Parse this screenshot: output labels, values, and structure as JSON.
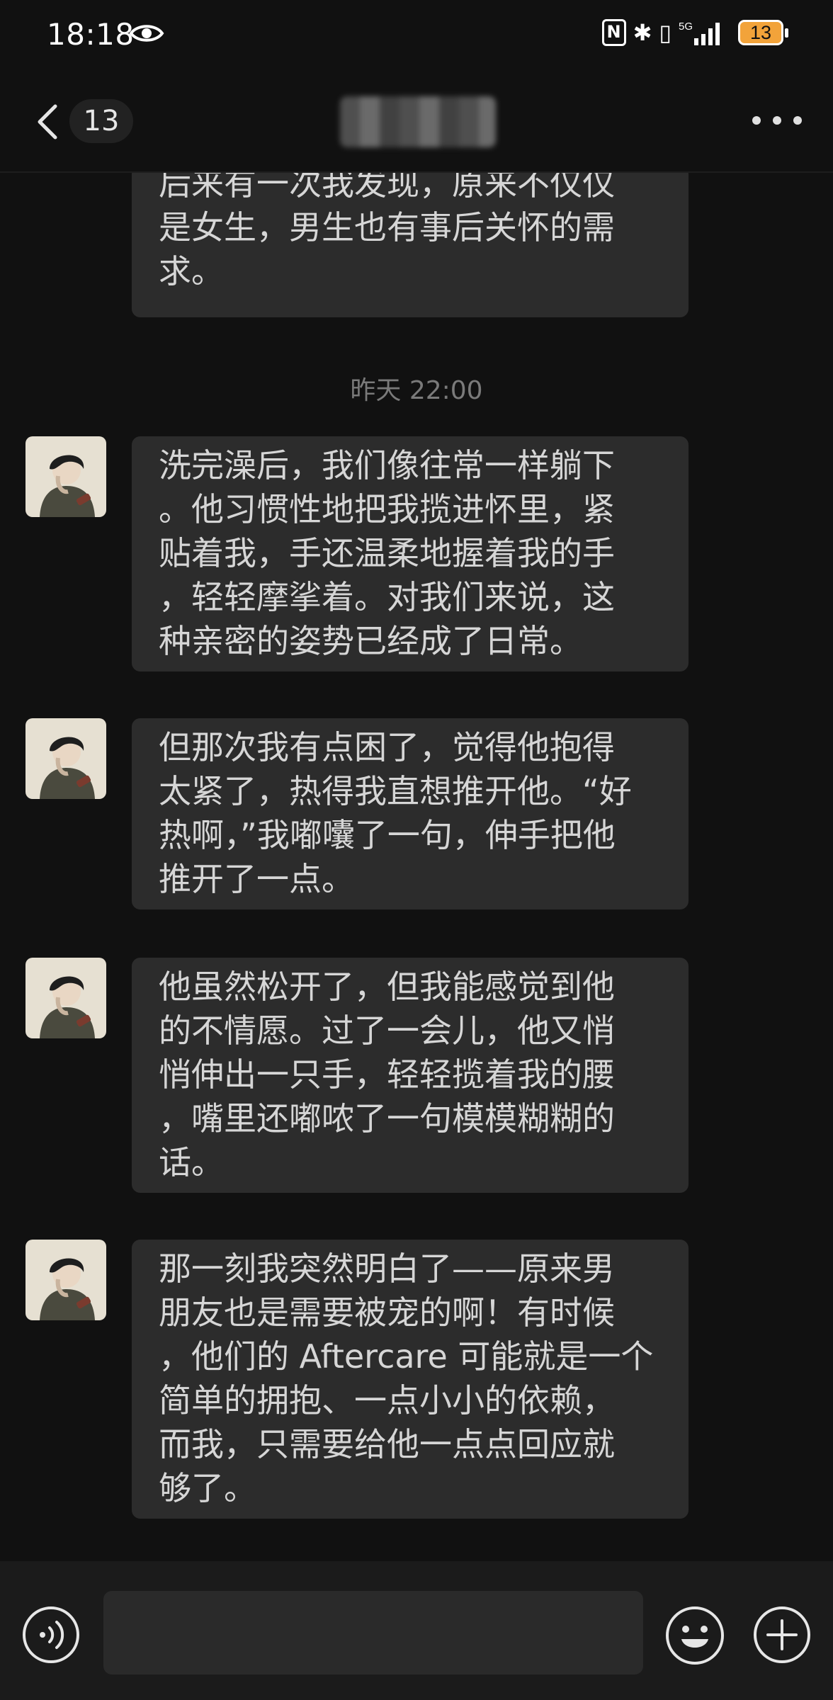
{
  "status_bar": {
    "time": "18:18",
    "battery_level": "13",
    "network_label": "5G",
    "nfc_glyph": "N",
    "bluetooth_glyph": "✱",
    "vibrate_glyph": "▯",
    "icons": [
      "eye-icon",
      "nfc-icon",
      "bluetooth-icon",
      "vibrate-icon",
      "signal-icon",
      "battery-icon"
    ]
  },
  "header": {
    "unread_count": "13",
    "icons": [
      "back-chevron-icon",
      "more-dots-icon"
    ]
  },
  "messages_top": {
    "partial_bubble_lines": [
      "后来有一次我发现，原来不仅仅",
      "是女生，男生也有事后关怀的需",
      "求。"
    ]
  },
  "timestamp": "昨天 22:00",
  "messages": [
    {
      "lines": [
        "洗完澡后，我们像往常一样躺下",
        "。他习惯性地把我揽进怀里，紧",
        "贴着我，手还温柔地握着我的手",
        "，轻轻摩挲着。对我们来说，这",
        "种亲密的姿势已经成了日常。"
      ]
    },
    {
      "lines": [
        "但那次我有点困了，觉得他抱得",
        "太紧了，热得我直想推开他。“好",
        "热啊，”我嘟囔了一句，伸手把他",
        "推开了一点。"
      ]
    },
    {
      "lines": [
        "他虽然松开了，但我能感觉到他",
        "的不情愿。过了一会儿，他又悄",
        "悄伸出一只手，轻轻揽着我的腰",
        "，嘴里还嘟哝了一句模模糊糊的",
        "话。"
      ]
    },
    {
      "lines": [
        "那一刻我突然明白了——原来男",
        "朋友也是需要被宠的啊！有时候",
        "，他们的 Aftercare 可能就是一个",
        "简单的拥抱、一点小小的依赖，",
        "而我，只需要给他一点点回应就",
        "够了。"
      ]
    }
  ],
  "input_bar": {
    "value": "",
    "icons": [
      "voice-icon",
      "emoji-icon",
      "plus-icon"
    ]
  },
  "colors": {
    "background": "#111111",
    "bubble": "#2c2c2c",
    "text": "#d6d6d6",
    "timestamp": "#7a7a7a",
    "battery_fill": "#f2a33a"
  }
}
